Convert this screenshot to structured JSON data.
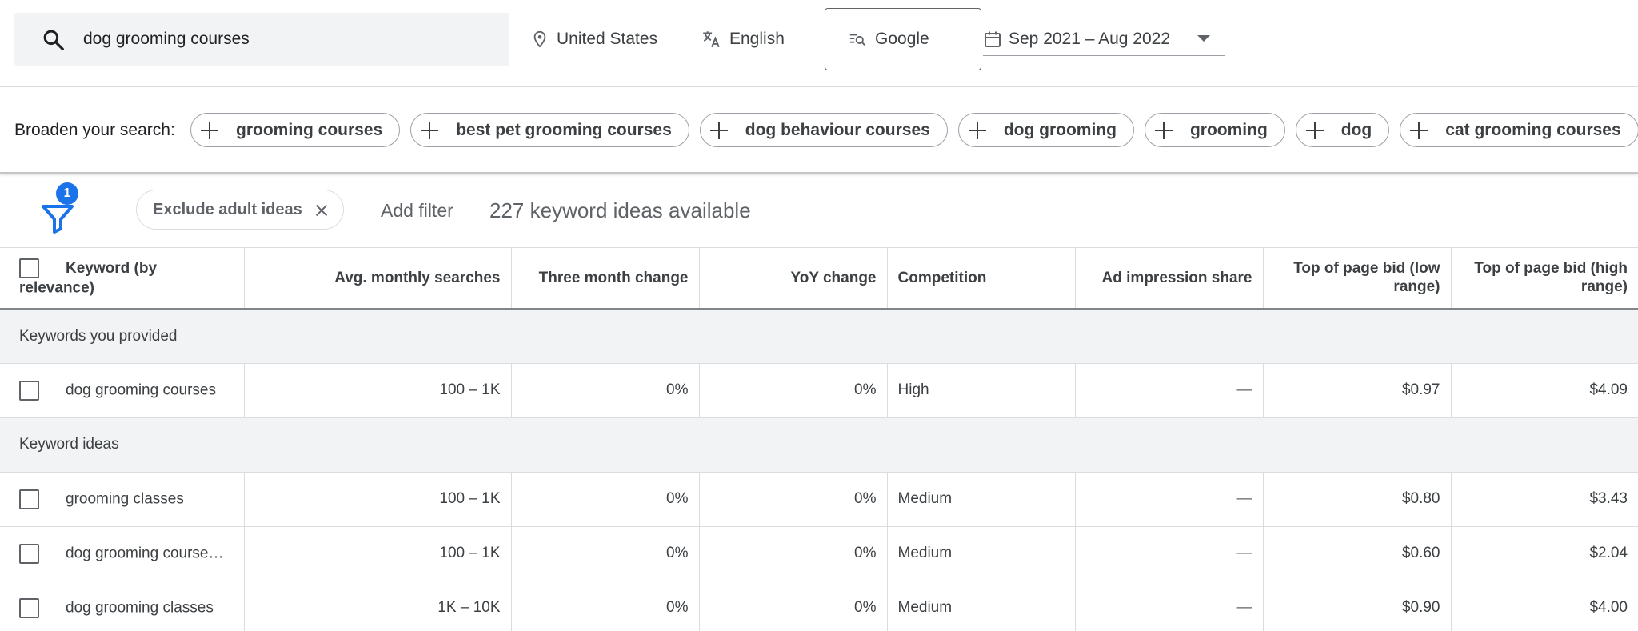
{
  "search": {
    "query": "dog grooming courses"
  },
  "location": "United States",
  "language": "English",
  "search_engine": "Google",
  "date_range": "Sep 2021 – Aug 2022",
  "broaden": {
    "label": "Broaden your search:",
    "chips": [
      "grooming courses",
      "best pet grooming courses",
      "dog behaviour courses",
      "dog grooming",
      "grooming",
      "dog",
      "cat grooming courses"
    ]
  },
  "filters": {
    "badge_count": "1",
    "applied": "Exclude adult ideas",
    "add_label": "Add filter",
    "ideas_available": "227 keyword ideas available"
  },
  "table": {
    "columns": {
      "keyword": "Keyword (by relevance)",
      "avg_searches": "Avg. monthly searches",
      "three_month": "Three month change",
      "yoy": "YoY change",
      "competition": "Competition",
      "impression_share": "Ad impression share",
      "bid_low": "Top of page bid (low range)",
      "bid_high": "Top of page bid (high range)"
    },
    "group_provided": "Keywords you provided",
    "provided": [
      {
        "keyword": "dog grooming courses",
        "avg": "100 – 1K",
        "three": "0%",
        "yoy": "0%",
        "comp": "High",
        "share": "—",
        "low": "$0.97",
        "high": "$4.09"
      }
    ],
    "group_ideas": "Keyword ideas",
    "ideas": [
      {
        "keyword": "grooming classes",
        "avg": "100 – 1K",
        "three": "0%",
        "yoy": "0%",
        "comp": "Medium",
        "share": "—",
        "low": "$0.80",
        "high": "$3.43"
      },
      {
        "keyword": "dog grooming course…",
        "avg": "100 – 1K",
        "three": "0%",
        "yoy": "0%",
        "comp": "Medium",
        "share": "—",
        "low": "$0.60",
        "high": "$2.04"
      },
      {
        "keyword": "dog grooming classes",
        "avg": "1K – 10K",
        "three": "0%",
        "yoy": "0%",
        "comp": "Medium",
        "share": "—",
        "low": "$0.90",
        "high": "$4.00"
      }
    ]
  },
  "icons": {
    "search": "search-icon",
    "location": "location-pin-icon",
    "language": "translate-icon",
    "engine": "search-engine-icon",
    "calendar": "calendar-icon",
    "add": "plus-icon",
    "filter": "filter-icon",
    "close": "close-icon"
  },
  "colors": {
    "accent": "#1a73e8",
    "group_bg": "#f1f3f4",
    "search_bg": "#f1f3f4"
  }
}
